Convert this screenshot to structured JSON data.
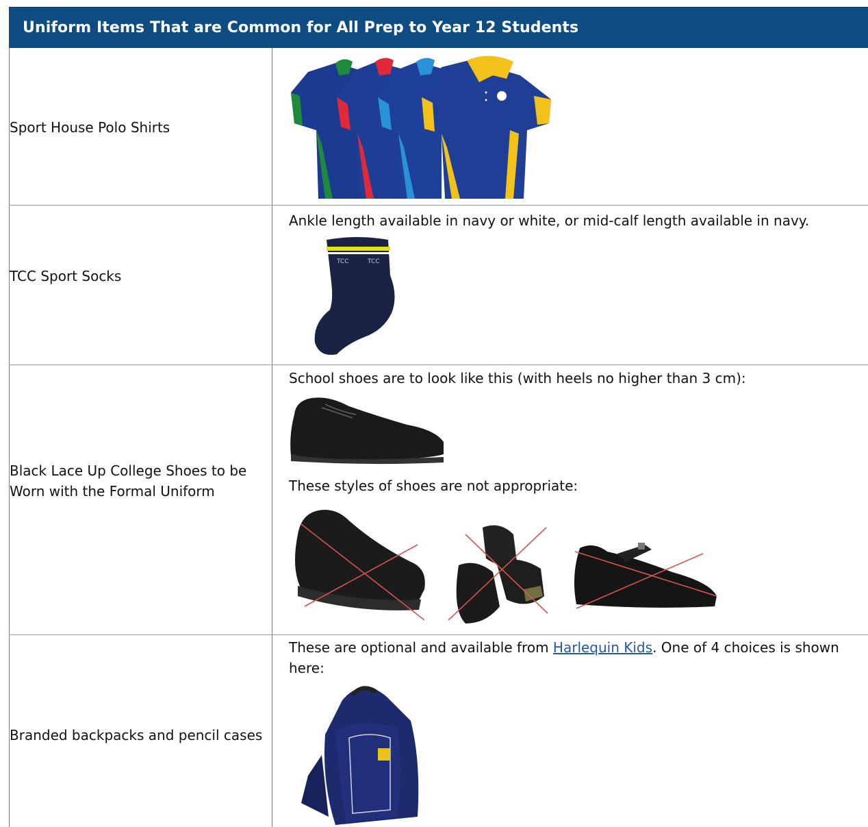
{
  "header": {
    "title": "Uniform Items That are Common for All Prep to Year 12 Students"
  },
  "rows": [
    {
      "label": "Sport House Polo Shirts",
      "image": "house-polo-shirts-image"
    },
    {
      "label": "TCC Sport Socks",
      "description": "Ankle length available in navy or white, or mid-calf length available in navy.",
      "image": "sport-sock-image",
      "sock_text": "TCC"
    },
    {
      "label_line1": "Black Lace Up College Shoes to be",
      "label_line2": "Worn with the Formal Uniform",
      "description": "School shoes are to look like this (with heels no higher than 3 cm):",
      "description2": "These styles of shoes are not appropriate:"
    },
    {
      "label": "Branded backpacks and pencil cases",
      "desc_part1": "These are optional and available from ",
      "link_text": "Harlequin Kids",
      "desc_part2": ". One of 4 choices is shown",
      "desc_line2": "here:"
    }
  ],
  "colors": {
    "header_bg": "#0f4c81",
    "link": "#1f5aa6",
    "cross": "#d9534f",
    "navy": "#1c2f6b"
  }
}
